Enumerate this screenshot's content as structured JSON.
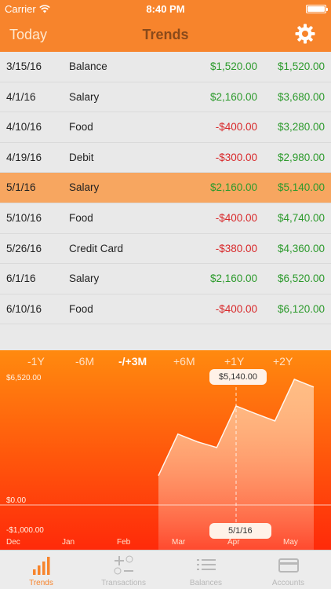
{
  "status_bar": {
    "carrier": "Carrier",
    "time": "8:40 PM"
  },
  "nav": {
    "left": "Today",
    "title": "Trends",
    "settings_icon": "gear-icon"
  },
  "transactions": [
    {
      "date": "3/15/16",
      "label": "Balance",
      "amount": "$1,520.00",
      "amount_sign": "pos",
      "balance": "$1,520.00"
    },
    {
      "date": "4/1/16",
      "label": "Salary",
      "amount": "$2,160.00",
      "amount_sign": "pos",
      "balance": "$3,680.00"
    },
    {
      "date": "4/10/16",
      "label": "Food",
      "amount": "-$400.00",
      "amount_sign": "neg",
      "balance": "$3,280.00"
    },
    {
      "date": "4/19/16",
      "label": "Debit",
      "amount": "-$300.00",
      "amount_sign": "neg",
      "balance": "$2,980.00"
    },
    {
      "date": "5/1/16",
      "label": "Salary",
      "amount": "$2,160.00",
      "amount_sign": "pos",
      "balance": "$5,140.00",
      "selected": true
    },
    {
      "date": "5/10/16",
      "label": "Food",
      "amount": "-$400.00",
      "amount_sign": "neg",
      "balance": "$4,740.00"
    },
    {
      "date": "5/26/16",
      "label": "Credit Card",
      "amount": "-$380.00",
      "amount_sign": "neg",
      "balance": "$4,360.00"
    },
    {
      "date": "6/1/16",
      "label": "Salary",
      "amount": "$2,160.00",
      "amount_sign": "pos",
      "balance": "$6,520.00"
    },
    {
      "date": "6/10/16",
      "label": "Food",
      "amount": "-$400.00",
      "amount_sign": "neg",
      "balance": "$6,120.00"
    }
  ],
  "range_options": [
    "-1Y",
    "-6M",
    "-/+3M",
    "+6M",
    "+1Y",
    "+2Y"
  ],
  "range_selected": "-/+3M",
  "chart_data": {
    "type": "area",
    "x_labels": [
      "Dec",
      "Jan",
      "Feb",
      "Mar",
      "Apr",
      "May"
    ],
    "y_tick_labels": [
      "$6,520.00",
      "$0.00",
      "-$1,000.00"
    ],
    "points": [
      1520,
      3680,
      3280,
      2980,
      5140,
      4740,
      4360,
      6520,
      6120
    ],
    "y_range": [
      -1000,
      6520
    ],
    "highlight": {
      "value": "$5,140.00",
      "date": "5/1/16"
    }
  },
  "tabs": [
    {
      "label": "Trends",
      "icon": "bar-chart-icon",
      "active": true
    },
    {
      "label": "Transactions",
      "icon": "plus-minus-icon",
      "active": false
    },
    {
      "label": "Balances",
      "icon": "list-icon",
      "active": false
    },
    {
      "label": "Accounts",
      "icon": "card-icon",
      "active": false
    }
  ]
}
